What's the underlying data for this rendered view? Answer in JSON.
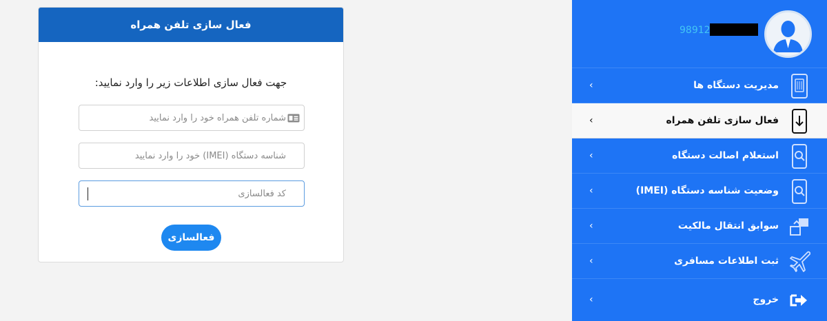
{
  "form": {
    "title": "فعال سازی تلفن همراه",
    "instruction": "جهت فعال سازی اطلاعات زیر را وارد نمایید:",
    "phone_placeholder": "شماره تلفن همراه خود را وارد نمایید",
    "imei_placeholder": "شناسه دستگاه (IMEI) خود را وارد نمایید",
    "code_placeholder": "کد فعالسازی",
    "submit_label": "فعالسازی"
  },
  "sidebar": {
    "phone_number": "98912",
    "items": [
      {
        "label": "مدیریت دستگاه ها",
        "icon": "phone-sim-icon",
        "chevron": "‹"
      },
      {
        "label": "فعال سازی تلفن همراه",
        "icon": "phone-download-icon",
        "chevron": "‹",
        "active": true
      },
      {
        "label": "استعلام اصالت دستگاه",
        "icon": "phone-search-icon",
        "chevron": "‹"
      },
      {
        "label": "وضعیت شناسه دستگاه (IMEI)",
        "icon": "phone-search-icon",
        "chevron": "‹"
      },
      {
        "label": "سوابق انتقال مالکیت",
        "icon": "transfer-icon",
        "chevron": "‹"
      },
      {
        "label": "ثبت اطلاعات مسافری",
        "icon": "airplane-icon",
        "chevron": "‹"
      },
      {
        "label": "خروج",
        "icon": "logout-icon",
        "chevron": "‹"
      }
    ]
  },
  "colors": {
    "header_blue": "#1565c0",
    "sidebar_blue": "#1e74f5",
    "button_blue": "#1e88f0",
    "phone_number_cyan": "#43c6f4"
  }
}
